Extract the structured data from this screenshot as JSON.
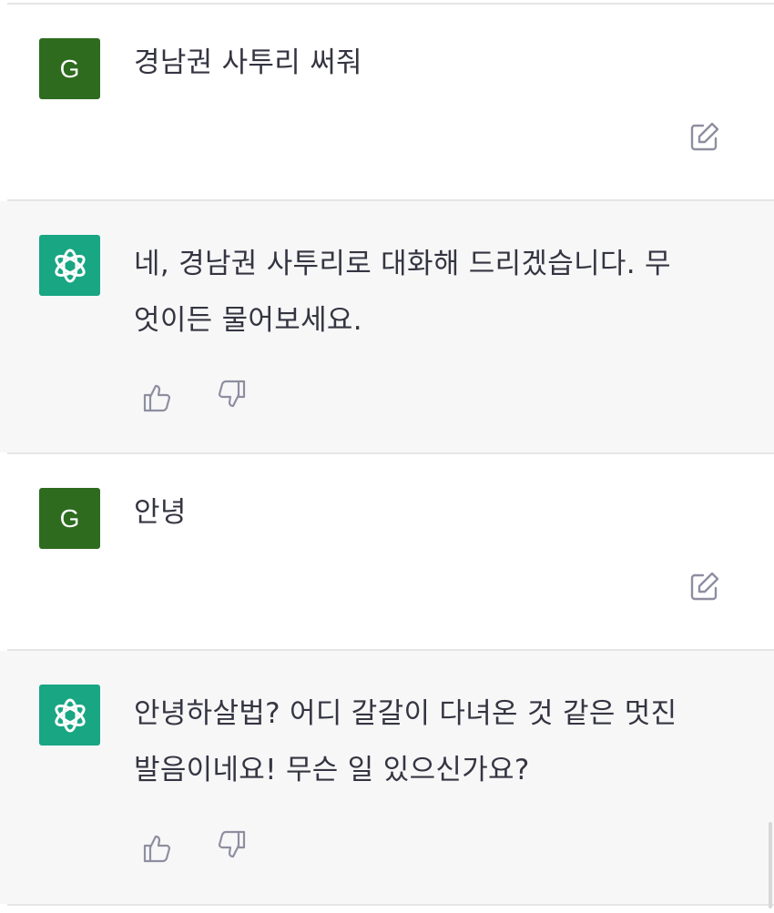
{
  "messages": [
    {
      "role": "user",
      "avatar_letter": "G",
      "text": "경남권 사투리 써줘",
      "icon": "edit-icon"
    },
    {
      "role": "assistant",
      "avatar_icon": "openai-logo-icon",
      "text": "네, 경남권 사투리로 대화해 드리겠습니다. 무\n엇이든 물어보세요.",
      "icons": [
        "thumbs-up-icon",
        "thumbs-down-icon"
      ]
    },
    {
      "role": "user",
      "avatar_letter": "G",
      "text": "안녕",
      "icon": "edit-icon"
    },
    {
      "role": "assistant",
      "avatar_icon": "openai-logo-icon",
      "text": "안녕하살법? 어디 갈갈이 다녀온 것 같은 멋진\n발음이네요! 무슨 일 있으신가요?",
      "icons": [
        "thumbs-up-icon",
        "thumbs-down-icon"
      ]
    }
  ],
  "colors": {
    "user_avatar": "#2e6b1f",
    "bot_avatar": "#19a683",
    "bot_bg": "#f7f7f8",
    "text": "#343541",
    "icon": "#8e8ea0"
  }
}
